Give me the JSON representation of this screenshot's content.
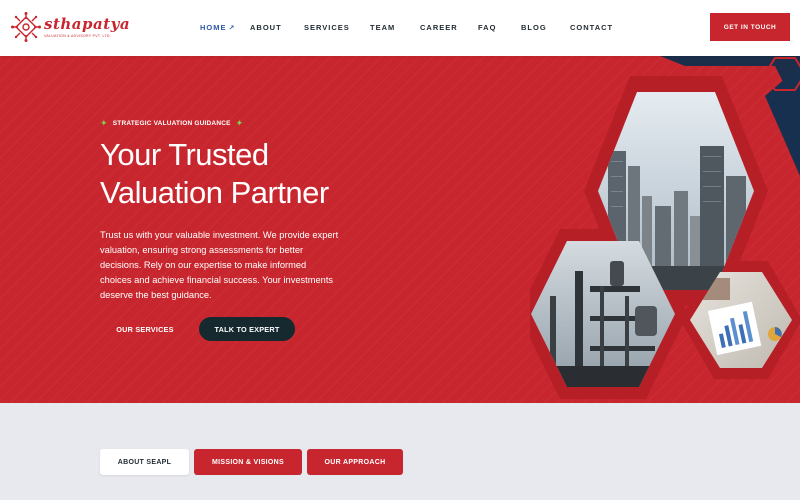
{
  "brand": {
    "name": "sthapatya",
    "tagline": "VALUATION & ADVISORY PVT. LTD.",
    "accent_color": "#c8262e",
    "dark_color": "#15292e"
  },
  "nav": {
    "items": [
      {
        "label": "HOME",
        "active": true,
        "icon": "arrow-up-right-icon"
      },
      {
        "label": "ABOUT"
      },
      {
        "label": "SERVICES"
      },
      {
        "label": "TEAM"
      },
      {
        "label": "CAREER"
      },
      {
        "label": "FAQ"
      },
      {
        "label": "BLOG"
      },
      {
        "label": "CONTACT"
      }
    ],
    "cta_label": "GET IN TOUCH"
  },
  "hero": {
    "eyebrow": "STRATEGIC VALUATION GUIDANCE",
    "title_line1": "Your Trusted",
    "title_line2": "Valuation Partner",
    "description": "Trust us with your valuable investment. We provide expert valuation, ensuring strong assessments for better decisions. Rely on our expertise to make informed choices and achieve financial success. Your investments deserve the best guidance.",
    "primary_button": "OUR SERVICES",
    "secondary_button": "TALK TO EXPERT",
    "images": [
      "city-skyline-image",
      "industrial-plant-image",
      "financial-charts-image"
    ]
  },
  "tabs": {
    "items": [
      {
        "label": "ABOUT SEAPL",
        "active": true
      },
      {
        "label": "MISSION & VISIONS"
      },
      {
        "label": "OUR APPROACH"
      }
    ]
  }
}
